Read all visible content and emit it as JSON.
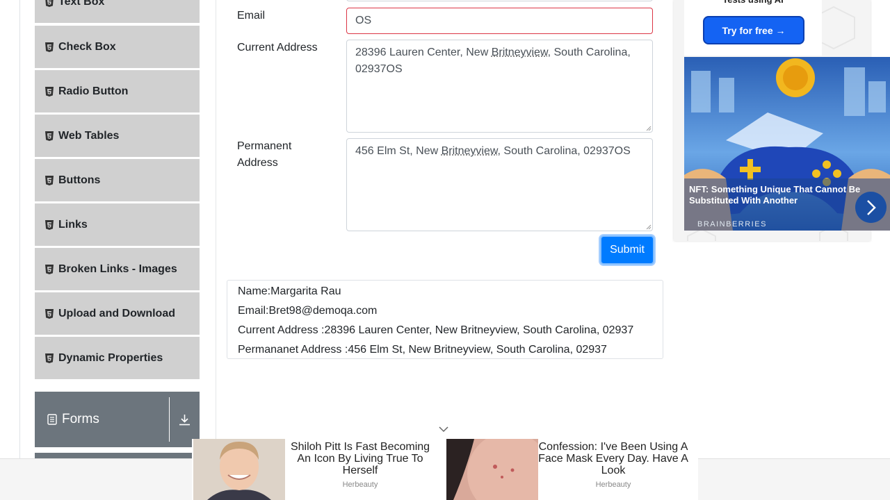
{
  "sidebar": {
    "items": [
      {
        "label": "Text Box"
      },
      {
        "label": "Check Box"
      },
      {
        "label": "Radio Button"
      },
      {
        "label": "Web Tables"
      },
      {
        "label": "Buttons"
      },
      {
        "label": "Links"
      },
      {
        "label": "Broken Links - Images"
      },
      {
        "label": "Upload and Download"
      },
      {
        "label": "Dynamic Properties"
      }
    ],
    "group": {
      "label": "Forms",
      "icon": "form-icon"
    }
  },
  "form": {
    "email_label": "Email",
    "email_value": "OS",
    "current_label": "Current Address",
    "current_value": {
      "p1": "28396 Lauren Center, New ",
      "u": "Britneyview",
      "p2": ", South Carolina, 02937OS"
    },
    "permanent_label_1": "Permanent",
    "permanent_label_2": "Address",
    "permanent_value": {
      "p1": "456 Elm St, New ",
      "u": "Britneyview",
      "p2": ", South Carolina, 02937OS"
    },
    "submit_label": "Submit"
  },
  "output": {
    "name": "Name:Margarita Rau",
    "email": "Email:Bret98@demoqa.com",
    "current": "Current Address :28396 Lauren Center, New Britneyview, South Carolina, 02937",
    "permanent": "Permananet Address :456 Elm St, New Britneyview, South Carolina, 02937"
  },
  "ad_right": {
    "top_text": "Tests using AI",
    "button": "Try for free →",
    "caption": "NFT: Something Unique That Cannot Be Substituted With Another",
    "brand": "BRAINBERRIES"
  },
  "ad_bottom": {
    "items": [
      {
        "headline": "Shiloh Pitt Is Fast Becoming An Icon By Living True To Herself",
        "source": "Herbeauty"
      },
      {
        "headline": "Confession: I've Been Using A Face Mask Every Day. Have A Look",
        "source": "Herbeauty"
      }
    ]
  },
  "colors": {
    "primary": "#007bff",
    "sidebar_item": "#d0d0d0",
    "sidebar_group": "#6c757d",
    "error": "#dc3545"
  }
}
